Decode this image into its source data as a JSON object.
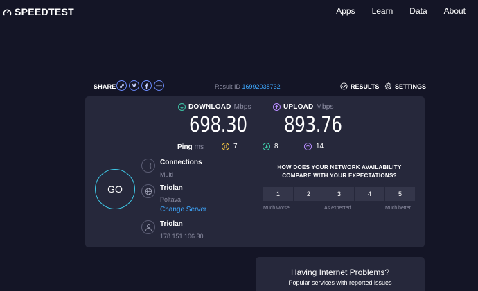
{
  "brand": {
    "name": "SPEEDTEST",
    "icon": "gauge-icon"
  },
  "nav": {
    "items": [
      {
        "label": "Apps"
      },
      {
        "label": "Learn"
      },
      {
        "label": "Data"
      },
      {
        "label": "About"
      }
    ]
  },
  "share": {
    "label": "SHARE",
    "icons": [
      "link-icon",
      "twitter-icon",
      "facebook-icon",
      "more-icon"
    ]
  },
  "result": {
    "label": "Result ID",
    "id": "16992038732"
  },
  "toolbar": {
    "results_label": "RESULTS",
    "settings_label": "SETTINGS"
  },
  "download": {
    "label": "DOWNLOAD",
    "unit": "Mbps",
    "value": "698.30",
    "color": "#3ec8a8"
  },
  "upload": {
    "label": "UPLOAD",
    "unit": "Mbps",
    "value": "893.76",
    "color": "#b78cff"
  },
  "ping": {
    "label": "Ping",
    "unit": "ms",
    "idle": "7",
    "download": "8",
    "upload": "14",
    "idle_color": "#f4c542"
  },
  "go": {
    "label": "GO",
    "color": "#3ec8e6"
  },
  "connections": {
    "title": "Connections",
    "value": "Multi"
  },
  "server": {
    "name": "Triolan",
    "location": "Poltava",
    "change_label": "Change Server"
  },
  "isp": {
    "name": "Triolan",
    "ip": "178.151.106.30"
  },
  "survey": {
    "question_line1": "HOW DOES YOUR NETWORK AVAILABILITY",
    "question_line2": "COMPARE WITH YOUR EXPECTATIONS?",
    "options": [
      "1",
      "2",
      "3",
      "4",
      "5"
    ],
    "low_label": "Much worse",
    "mid_label": "As expected",
    "high_label": "Much better"
  },
  "problems": {
    "title": "Having Internet Problems?",
    "subtitle": "Popular services with reported issues"
  }
}
